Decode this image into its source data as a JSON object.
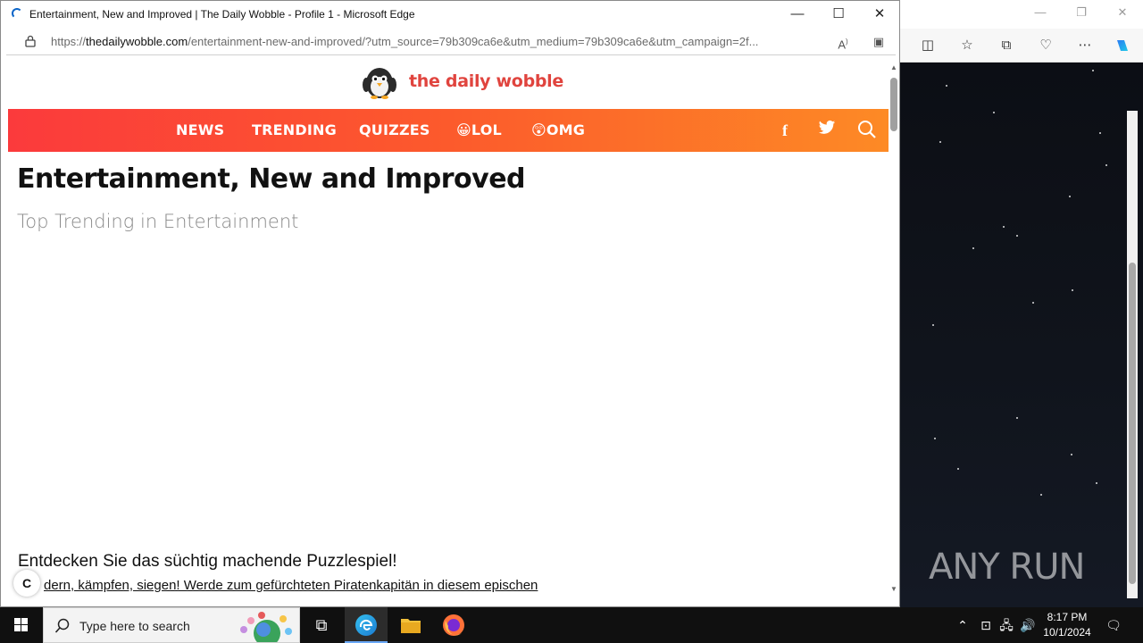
{
  "browser": {
    "window_title": "Entertainment, New and Improved | The Daily Wobble - Profile 1 - Microsoft Edge",
    "url_prefix": "https://",
    "url_domain": "thedailywobble.com",
    "url_path": "/entertainment-new-and-improved/?utm_source=79b309ca6e&utm_medium=79b309ca6e&utm_campaign=2f..."
  },
  "site": {
    "logo_text": "the daily wobble",
    "nav": {
      "news": "NEWS",
      "trending": "TRENDING",
      "quizzes": "QUIZZES",
      "lol": "😀LOL",
      "omg": "😲OMG"
    }
  },
  "article": {
    "headline": "Entertainment, New and Improved",
    "subheading": "Top Trending in Entertainment"
  },
  "promo": {
    "title": "Entdecken Sie das süchtig machende Puzzlespiel!",
    "link": "dern, kämpfen, siegen! Werde zum gefürchteten Piratenkapitän in diesem epischen",
    "badge": "C"
  },
  "watermark": "ANY RUN",
  "taskbar": {
    "search_placeholder": "Type here to search",
    "time": "8:17 PM",
    "date": "10/1/2024"
  },
  "colors": {
    "nav_gradient_start": "#fb3a3c",
    "nav_gradient_end": "#fd8a25",
    "logo": "#e0443e"
  }
}
